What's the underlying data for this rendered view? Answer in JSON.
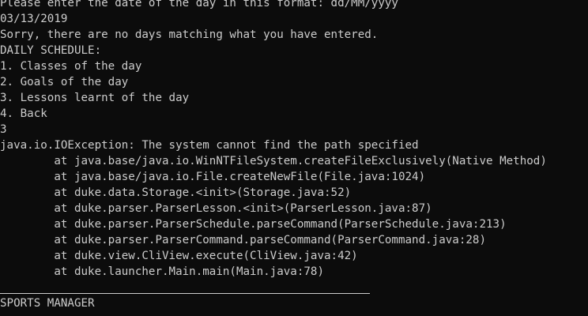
{
  "console": {
    "lines": [
      "Please enter the date of the day in this format: dd/MM/yyyy",
      "03/13/2019",
      "Sorry, there are no days matching what you have entered.",
      "DAILY SCHEDULE:",
      "1. Classes of the day",
      "2. Goals of the day",
      "3. Lessons learnt of the day",
      "4. Back",
      "3",
      "java.io.IOException: The system cannot find the path specified",
      "        at java.base/java.io.WinNTFileSystem.createFileExclusively(Native Method)",
      "        at java.base/java.io.File.createNewFile(File.java:1024)",
      "        at duke.data.Storage.<init>(Storage.java:52)",
      "        at duke.parser.ParserLesson.<init>(ParserLesson.java:87)",
      "        at duke.parser.ParserSchedule.parseCommand(ParserSchedule.java:213)",
      "        at duke.parser.ParserCommand.parseCommand(ParserCommand.java:28)",
      "        at duke.view.CliView.execute(CliView.java:42)",
      "        at duke.launcher.Main.main(Main.java:78)",
      "",
      "SPORTS MANAGER"
    ]
  }
}
